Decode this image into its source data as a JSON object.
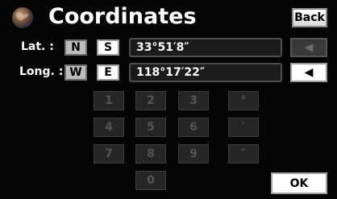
{
  "header": {
    "title": "Coordinates",
    "back_label": "Back",
    "globe_icon": "globe-icon"
  },
  "latitude": {
    "label": "Lat. :",
    "dir_options": [
      "N",
      "S"
    ],
    "selected": "N",
    "value": "33°51′8″",
    "arrow_icon": "left-arrow-icon",
    "arrow_glyph": "◀",
    "arrow_enabled": false
  },
  "longitude": {
    "label": "Long. :",
    "dir_options": [
      "W",
      "E"
    ],
    "selected": "W",
    "value": "118°17′22″",
    "arrow_icon": "left-arrow-icon",
    "arrow_glyph": "◀",
    "arrow_enabled": true
  },
  "keypad": {
    "row1": [
      "1",
      "2",
      "3",
      "°"
    ],
    "row2": [
      "4",
      "5",
      "6",
      "′"
    ],
    "row3": [
      "7",
      "8",
      "9",
      "″"
    ],
    "zero": "0",
    "enabled": false
  },
  "ok_label": "OK",
  "colors": {
    "background": "#050505",
    "selected_button": "#bdbdbd",
    "button": "#ffffff",
    "disabled_key": "#262626"
  }
}
